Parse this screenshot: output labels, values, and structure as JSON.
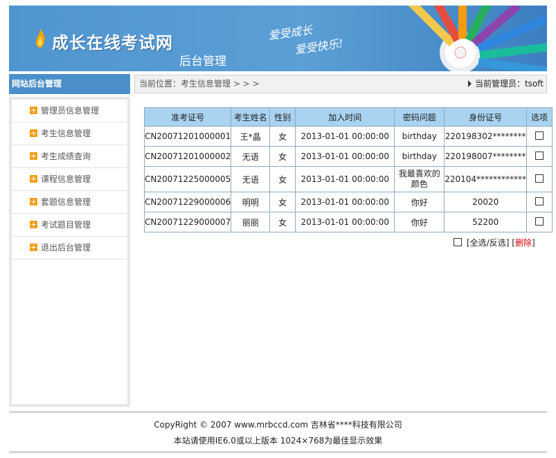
{
  "header": {
    "site_title": "成长在线考试网",
    "sub_title": "后台管理",
    "slogan_line1": "爱受成长",
    "slogan_line2": "爱受快乐!"
  },
  "sidebar": {
    "heading": "网站后台管理",
    "items": [
      {
        "label": "管理员信息管理"
      },
      {
        "label": "考生信息管理"
      },
      {
        "label": "考生成绩查询"
      },
      {
        "label": "课程信息管理"
      },
      {
        "label": "套题信息管理"
      },
      {
        "label": "考试题目管理"
      },
      {
        "label": "退出后台管理"
      }
    ]
  },
  "breadcrumb": {
    "text": "当前位置：考生信息管理 > > >",
    "admin_text": "当前管理员：tsoft"
  },
  "table": {
    "headers": [
      "准考证号",
      "考生姓名",
      "性别",
      "加入时间",
      "密码问题",
      "身份证号",
      "选项"
    ],
    "rows": [
      {
        "id": "CN20071201000001",
        "name": "王*晶",
        "gender": "女",
        "time": "2013-01-01 00:00:00",
        "question": "birthday",
        "idcard": "220198302********"
      },
      {
        "id": "CN20071201000002",
        "name": "无语",
        "gender": "女",
        "time": "2013-01-01 00:00:00",
        "question": "birthday",
        "idcard": "220198007********"
      },
      {
        "id": "CN20071225000005",
        "name": "无语",
        "gender": "女",
        "time": "2013-01-01 00:00:00",
        "question": "我最喜欢的颜色",
        "idcard": "220104************"
      },
      {
        "id": "CN20071229000006",
        "name": "明明",
        "gender": "女",
        "time": "2013-01-01 00:00:00",
        "question": "你好",
        "idcard": "20020"
      },
      {
        "id": "CN20071229000007",
        "name": "丽丽",
        "gender": "女",
        "time": "2013-01-01 00:00:00",
        "question": "你好",
        "idcard": "52200"
      }
    ]
  },
  "actions": {
    "select_all": "[全选/反选]",
    "delete_open": "[",
    "delete": "删除",
    "delete_close": "]"
  },
  "footer": {
    "copyright": "CopyRight © 2007 www.mrbccd.com 吉林省****科技有限公司",
    "note": "本站请使用IE6.0或以上版本 1024×768为最佳显示效果"
  },
  "colors": {
    "banner_blue": "#4a8fc9",
    "table_header": "#a9d3f0",
    "accent_orange": "#f39c12",
    "delete_red": "#dd0000"
  }
}
